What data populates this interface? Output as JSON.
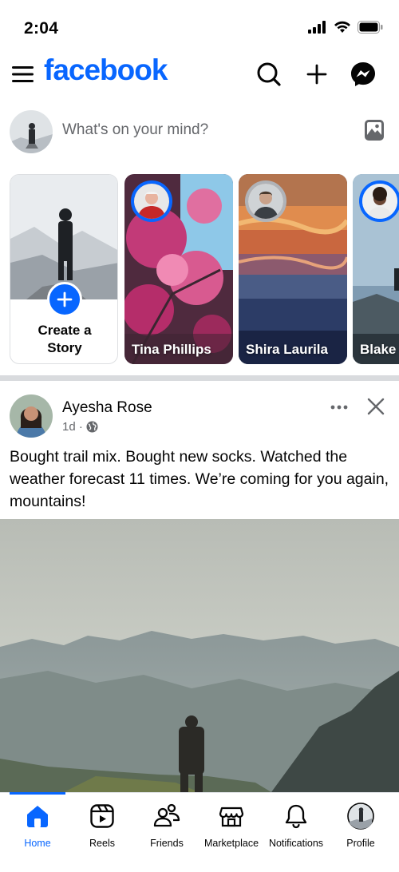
{
  "status": {
    "time": "2:04"
  },
  "header": {
    "logo": "facebook"
  },
  "composer": {
    "placeholder": "What's on your mind?"
  },
  "stories": {
    "create_label": "Create a Story",
    "items": [
      {
        "name": "Tina Phillips"
      },
      {
        "name": "Shira Laurila"
      },
      {
        "name": "Blake"
      }
    ]
  },
  "post": {
    "author": "Ayesha Rose",
    "time": "1d ·",
    "text": "Bought trail mix. Bought new socks. Watched the weather forecast 11 times. We’re coming for you again, mountains!"
  },
  "tabs": [
    {
      "label": "Home",
      "icon": "home-icon",
      "active": true
    },
    {
      "label": "Reels",
      "icon": "reels-icon"
    },
    {
      "label": "Friends",
      "icon": "friends-icon"
    },
    {
      "label": "Marketplace",
      "icon": "marketplace-icon"
    },
    {
      "label": "Notifications",
      "icon": "bell-icon"
    },
    {
      "label": "Profile",
      "icon": "profile-avatar"
    }
  ],
  "colors": {
    "brand": "#0866ff",
    "secondary_text": "#65676b"
  }
}
